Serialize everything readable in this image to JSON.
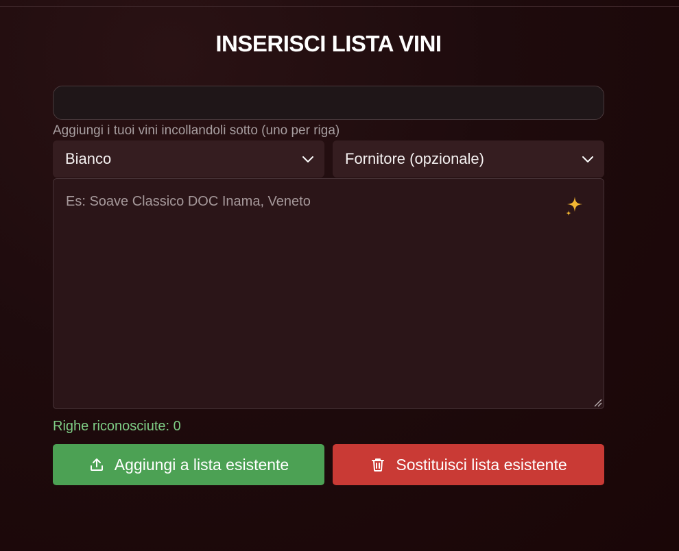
{
  "page": {
    "title": "INSERISCI LISTA VINI"
  },
  "list_name_input": {
    "value": "",
    "placeholder": ""
  },
  "helper_text": "Aggiungi i tuoi vini incollandoli sotto (uno per riga)",
  "wine_type_select": {
    "selected": "Bianco"
  },
  "supplier_select": {
    "selected": "Fornitore (opzionale)"
  },
  "wine_textarea": {
    "value": "",
    "placeholder": "Es: Soave Classico DOC Inama, Veneto"
  },
  "recognized_rows": {
    "text": "Righe riconosciute: 0",
    "count": 0
  },
  "actions": {
    "add_label": "Aggiungi a lista esistente",
    "replace_label": "Sostituisci lista esistente"
  },
  "icons": {
    "ai": "sparkles-icon",
    "add": "upload-icon",
    "replace": "trash-icon",
    "select": "chevron-down-icon"
  },
  "colors": {
    "add_button": "#4ca154",
    "replace_button": "#c93a35",
    "count_text": "#7fce86",
    "sparkle": "#f2b632"
  }
}
